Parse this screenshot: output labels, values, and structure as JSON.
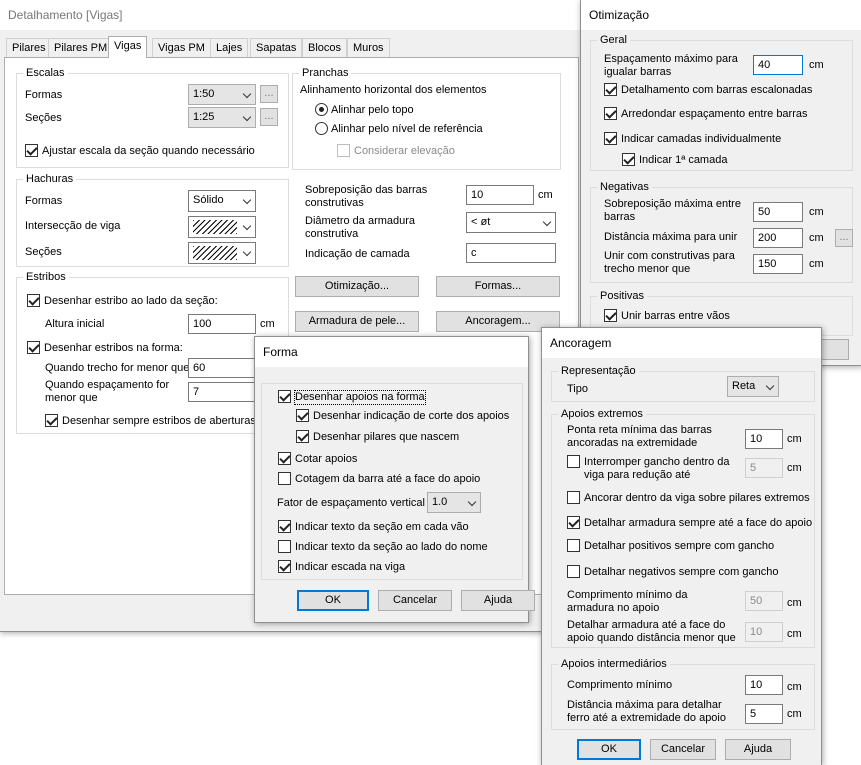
{
  "main": {
    "title": "Detalhamento [Vigas]",
    "tabs": [
      "Pilares",
      "Pilares PM",
      "Vigas",
      "Vigas PM",
      "Lajes",
      "Sapatas",
      "Blocos",
      "Muros"
    ],
    "escalas": {
      "title": "Escalas",
      "formas_label": "Formas",
      "formas_value": "1:50",
      "secoes_label": "Seções",
      "secoes_value": "1:25",
      "ellipsis": "...",
      "ajustar_label": "Ajustar escala da seção quando necessário"
    },
    "pranchas": {
      "title": "Pranchas",
      "alinhamento_label": "Alinhamento horizontal dos elementos",
      "radio_topo": "Alinhar pelo topo",
      "radio_nivel": "Alinhar pelo nível de referência",
      "considerar": "Considerar elevação"
    },
    "hachuras": {
      "title": "Hachuras",
      "formas_label": "Formas",
      "formas_value": "Sólido",
      "intersecao_label": "Intersecção de viga",
      "secoes_label": "Seções"
    },
    "sobreposicao": {
      "label": "Sobreposição das barras construtivas",
      "value": "10",
      "unit": "cm"
    },
    "diametro": {
      "label": "Diâmetro da armadura construtiva",
      "value": "< øt"
    },
    "indicacao": {
      "label": "Indicação de camada",
      "value": "c"
    },
    "buttons": {
      "otimizacao": "Otimização...",
      "formas": "Formas...",
      "armadura": "Armadura de pele...",
      "ancoragem": "Ancoragem..."
    },
    "estribos": {
      "title": "Estribos",
      "desenhar_lado": "Desenhar estribo ao lado da seção:",
      "altura_label": "Altura inicial",
      "altura_value": "100",
      "unit": "cm",
      "desenhar_forma": "Desenhar estribos na forma:",
      "trecho_label": "Quando trecho for menor que",
      "trecho_value": "60",
      "espacamento_label": "Quando espaçamento for menor que",
      "espacamento_value": "7",
      "aberturas": "Desenhar sempre estribos de aberturas"
    }
  },
  "otimizacao": {
    "title": "Otimização",
    "geral": {
      "title": "Geral",
      "esp_label": "Espaçamento máximo para igualar barras",
      "esp_value": "40",
      "unit": "cm",
      "escalonadas": "Detalhamento com barras escalonadas",
      "arredondar": "Arredondar espaçamento entre barras",
      "camadas": "Indicar camadas individualmente",
      "primeira": "Indicar 1ª camada"
    },
    "negativas": {
      "title": "Negativas",
      "sobre_label": "Sobreposição máxima entre barras",
      "sobre_value": "50",
      "dist_label": "Distância máxima para unir",
      "dist_value": "200",
      "unir_label": "Unir com construtivas para trecho menor que",
      "unir_value": "150",
      "unit": "cm",
      "ellipsis": "..."
    },
    "positivas": {
      "title": "Positivas",
      "unir": "Unir barras entre vãos"
    }
  },
  "forma": {
    "title": "Forma",
    "apoios": "Desenhar apoios na forma",
    "corte": "Desenhar indicação de corte dos apoios",
    "pilares": "Desenhar pilares que nascem",
    "cotar": "Cotar apoios",
    "cotagem": "Cotagem da barra até a face do apoio",
    "fator_label": "Fator de espaçamento vertical",
    "fator_value": "1.0",
    "texto_vao": "Indicar texto da seção em cada vão",
    "texto_nome": "Indicar texto da seção ao lado do nome",
    "escada": "Indicar escada na viga",
    "ok": "OK",
    "cancelar": "Cancelar",
    "ajuda": "Ajuda"
  },
  "ancoragem": {
    "title": "Ancoragem",
    "representacao": {
      "title": "Representação",
      "tipo_label": "Tipo",
      "tipo_value": "Reta"
    },
    "extremos": {
      "title": "Apoios extremos",
      "ponta_label": "Ponta reta mínima das barras ancoradas na extremidade",
      "ponta_value": "10",
      "interromper": "Interromper gancho dentro da viga para redução até",
      "interromper_value": "5",
      "ancorar": "Ancorar dentro da viga sobre pilares extremos",
      "detalhar_face": "Detalhar armadura sempre até a face do apoio",
      "positivos": "Detalhar positivos sempre com gancho",
      "negativos": "Detalhar negativos sempre com gancho",
      "comp_label": "Comprimento mínimo da armadura no apoio",
      "comp_value": "50",
      "dist_label": "Detalhar armadura até a face do apoio quando distância menor que",
      "dist_value": "10",
      "unit": "cm"
    },
    "intermediarios": {
      "title": "Apoios intermediários",
      "comp_label": "Comprimento mínimo",
      "comp_value": "10",
      "dist_label": "Distância máxima para detalhar ferro até a extremidade do apoio",
      "dist_value": "5",
      "unit": "cm"
    },
    "ok": "OK",
    "cancelar": "Cancelar",
    "ajuda": "Ajuda"
  }
}
